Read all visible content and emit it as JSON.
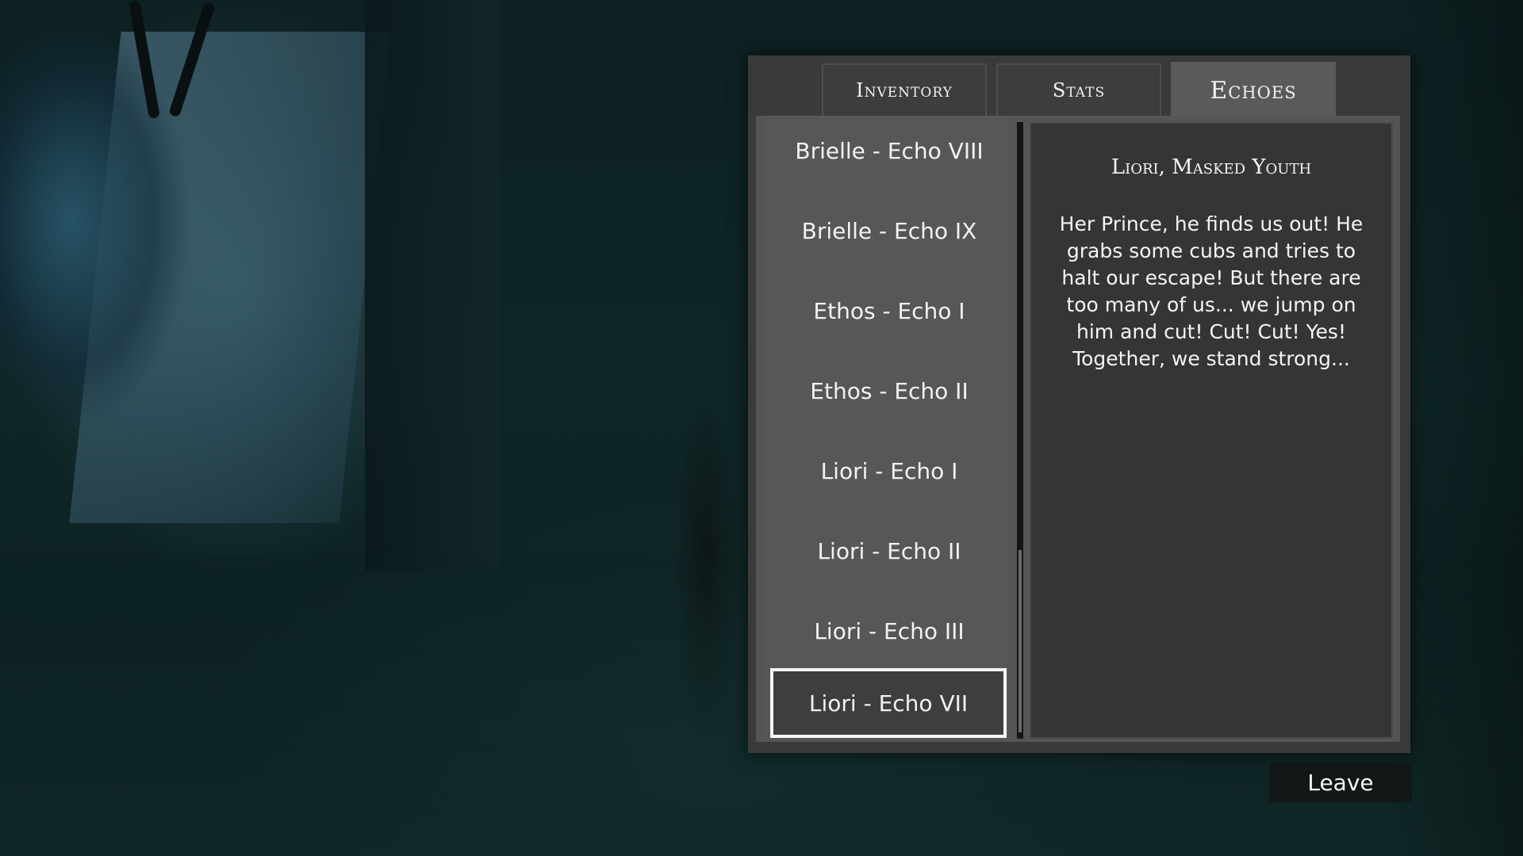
{
  "tabs": [
    {
      "label": "Inventory"
    },
    {
      "label": "Stats"
    },
    {
      "label": "Echoes"
    }
  ],
  "active_tab": "Echoes",
  "echo_list": {
    "items": [
      {
        "label": "Brielle - Echo VIII"
      },
      {
        "label": "Brielle - Echo IX"
      },
      {
        "label": "Ethos - Echo I"
      },
      {
        "label": "Ethos - Echo II"
      },
      {
        "label": "Liori - Echo I"
      },
      {
        "label": "Liori - Echo II"
      },
      {
        "label": "Liori - Echo III"
      },
      {
        "label": "Liori - Echo VII"
      }
    ],
    "selected_index": 7
  },
  "detail": {
    "title": "Liori, Masked Youth",
    "body": "Her Prince, he finds us out! He grabs some cubs and tries to halt our escape! But there are too many of us... we jump on him and cut! Cut! Cut! Yes! Together, we stand strong..."
  },
  "footer": {
    "leave_label": "Leave"
  }
}
